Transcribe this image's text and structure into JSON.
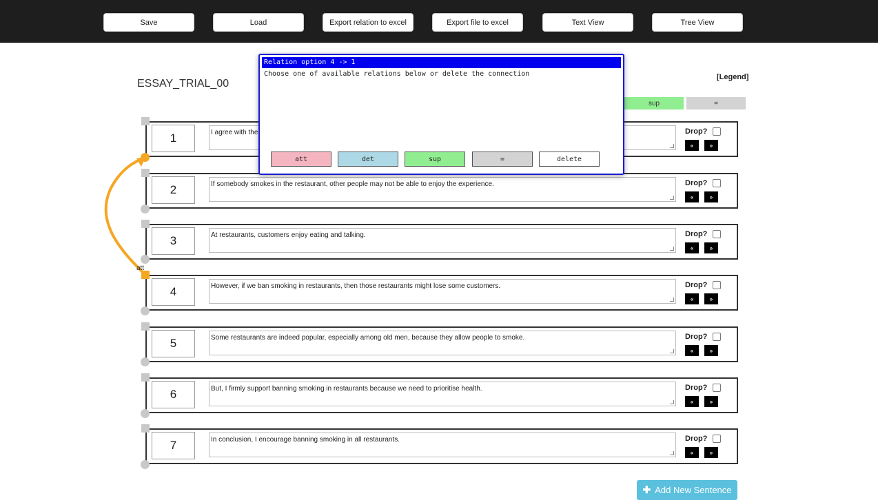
{
  "toolbar": {
    "save": "Save",
    "load": "Load",
    "export_relation": "Export relation to excel",
    "export_file": "Export file to excel",
    "text_view": "Text View",
    "tree_view": "Tree View"
  },
  "essay": {
    "title": "ESSAY_TRIAL_00",
    "legend_link": "[Legend]",
    "legend_sup": "sup",
    "legend_eq": "="
  },
  "sentences": [
    {
      "num": "1",
      "text": "I agree with the"
    },
    {
      "num": "2",
      "text": "If somebody smokes in the restaurant, other people may not be able to enjoy the experience."
    },
    {
      "num": "3",
      "text": "At restaurants, customers enjoy eating and talking."
    },
    {
      "num": "4",
      "text": "However, if we ban smoking in restaurants, then those restaurants might lose some customers."
    },
    {
      "num": "5",
      "text": "Some restaurants are indeed popular, especially among old men, because they allow people to smoke."
    },
    {
      "num": "6",
      "text": "But, I firmly support banning smoking in restaurants because we need to prioritise health."
    },
    {
      "num": "7",
      "text": "In conclusion, I encourage banning smoking in all restaurants."
    }
  ],
  "row_controls": {
    "drop_label": "Drop?",
    "move_up": "«",
    "move_down": "»"
  },
  "connection": {
    "label": "att",
    "color": "#f5a623"
  },
  "dialog": {
    "title": "Relation option 4 -> 1",
    "text": "Choose one of available relations below or delete the connection",
    "att": "att",
    "det": "det",
    "sup": "sup",
    "eq": "=",
    "delete": "delete"
  },
  "add_button": {
    "icon": "plus-icon",
    "label": "Add New Sentence"
  },
  "colors": {
    "att": "#f5b5c0",
    "det": "#add8e6",
    "sup": "#90ee90",
    "eq": "#d3d3d3",
    "dialog_border": "#1a1ad6",
    "dialog_title_bg": "#0000ee",
    "add_button": "#5bc0de"
  }
}
